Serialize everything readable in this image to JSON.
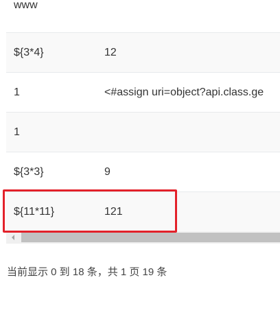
{
  "table": {
    "rows": [
      {
        "col1": "www",
        "col2": ""
      },
      {
        "col1": "${3*4}",
        "col2": "12"
      },
      {
        "col1": "1",
        "col2": "<#assign uri=object?api.class.ge"
      },
      {
        "col1": "1",
        "col2": ""
      },
      {
        "col1": "${3*3}",
        "col2": "9"
      },
      {
        "col1": "${11*11}",
        "col2": "121"
      }
    ]
  },
  "footer": {
    "info": "当前显示 0 到 18 条，共 1 页 19 条"
  },
  "colors": {
    "highlight": "#e3212a",
    "stripe": "#f9f9f9",
    "border": "#e7eaec"
  }
}
